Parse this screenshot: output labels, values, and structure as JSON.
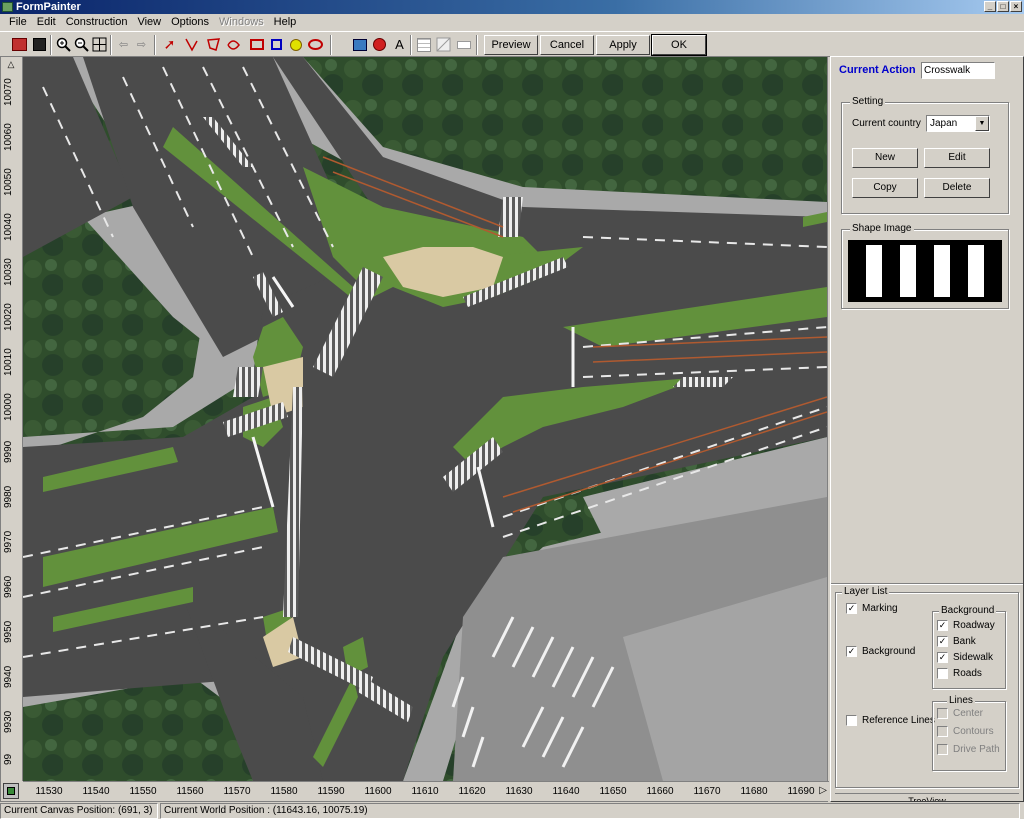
{
  "app": {
    "title": "FormPainter"
  },
  "menu": [
    "File",
    "Edit",
    "Construction",
    "View",
    "Options",
    "Windows",
    "Help"
  ],
  "toolbar": {
    "preview": "Preview",
    "cancel": "Cancel",
    "apply": "Apply",
    "ok": "OK",
    "text_tool": "A"
  },
  "vruler": [
    "10070",
    "10060",
    "10050",
    "10040",
    "10030",
    "10020",
    "10010",
    "10000",
    "9990",
    "9980",
    "9970",
    "9960",
    "9950",
    "9940",
    "9930",
    "99"
  ],
  "hruler": [
    "11530",
    "11540",
    "11550",
    "11560",
    "11570",
    "11580",
    "11590",
    "11600",
    "11610",
    "11620",
    "11630",
    "11640",
    "11650",
    "11660",
    "11670",
    "11680",
    "11690"
  ],
  "panel": {
    "current_action_label": "Current Action",
    "current_action_value": "Crosswalk",
    "setting": {
      "legend": "Setting",
      "country_label": "Current country",
      "country_value": "Japan",
      "new": "New",
      "edit": "Edit",
      "copy": "Copy",
      "delete": "Delete"
    },
    "shape_image": {
      "legend": "Shape Image"
    },
    "layer_list": {
      "legend": "Layer List",
      "marking": "Marking",
      "background": "Background",
      "reference_lines": "Reference Lines",
      "background_group": {
        "legend": "Background",
        "roadway": "Roadway",
        "bank": "Bank",
        "sidewalk": "Sidewalk",
        "roads": "Roads"
      },
      "lines_group": {
        "legend": "Lines",
        "center": "Center",
        "contours": "Contours",
        "drive_path": "Drive Path"
      }
    },
    "tab_label": "TreeView"
  },
  "status": {
    "canvas_position": "Current Canvas Position: (691, 3)",
    "world_position": "Current World Position : (11643.16, 10075.19)"
  },
  "colors": {
    "accent": "#0000cc",
    "road": "#4a4a4a",
    "grass": "#5e8a3a",
    "sidewalk": "#a8a8a8",
    "background_vegetation": "#2d4a2a"
  }
}
